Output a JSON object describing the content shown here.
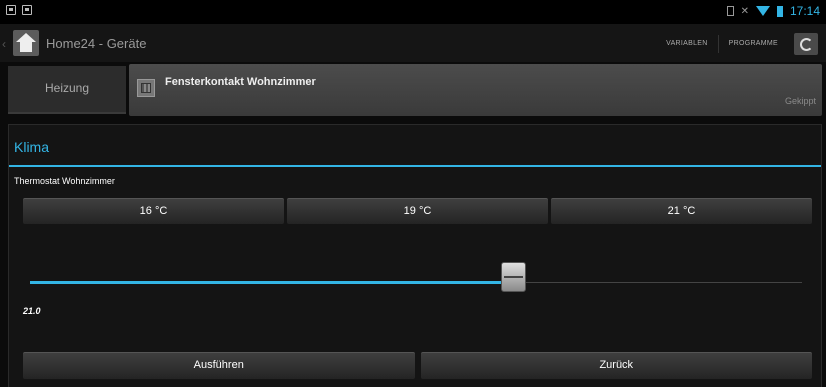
{
  "status_bar": {
    "left_icons": [
      "notification-icon",
      "notification-icon"
    ],
    "right_icons": [
      "sim-icon",
      "signal-icon",
      "wifi-icon",
      "battery-icon"
    ],
    "time": "17:14",
    "accent": "#33b5e5"
  },
  "action_bar": {
    "title": "Home24 - Geräte",
    "actions": [
      "VARIABLEN",
      "PROGRAMME"
    ],
    "icons": [
      "home-logo-icon",
      "refresh-icon"
    ]
  },
  "sidebar": {
    "items": [
      {
        "label": "Heizung"
      }
    ]
  },
  "device": {
    "name": "Fensterkontakt Wohnzimmer",
    "status": "Gekippt",
    "icon": "window-icon"
  },
  "dialog": {
    "title": "Klima",
    "thermostat_label": "Thermostat Wohnzimmer",
    "presets": [
      "16 °C",
      "19 °C",
      "21 °C"
    ],
    "slider": {
      "value": "21.0",
      "level": 0.626
    },
    "buttons": {
      "execute": "Ausführen",
      "back": "Zurück"
    }
  }
}
